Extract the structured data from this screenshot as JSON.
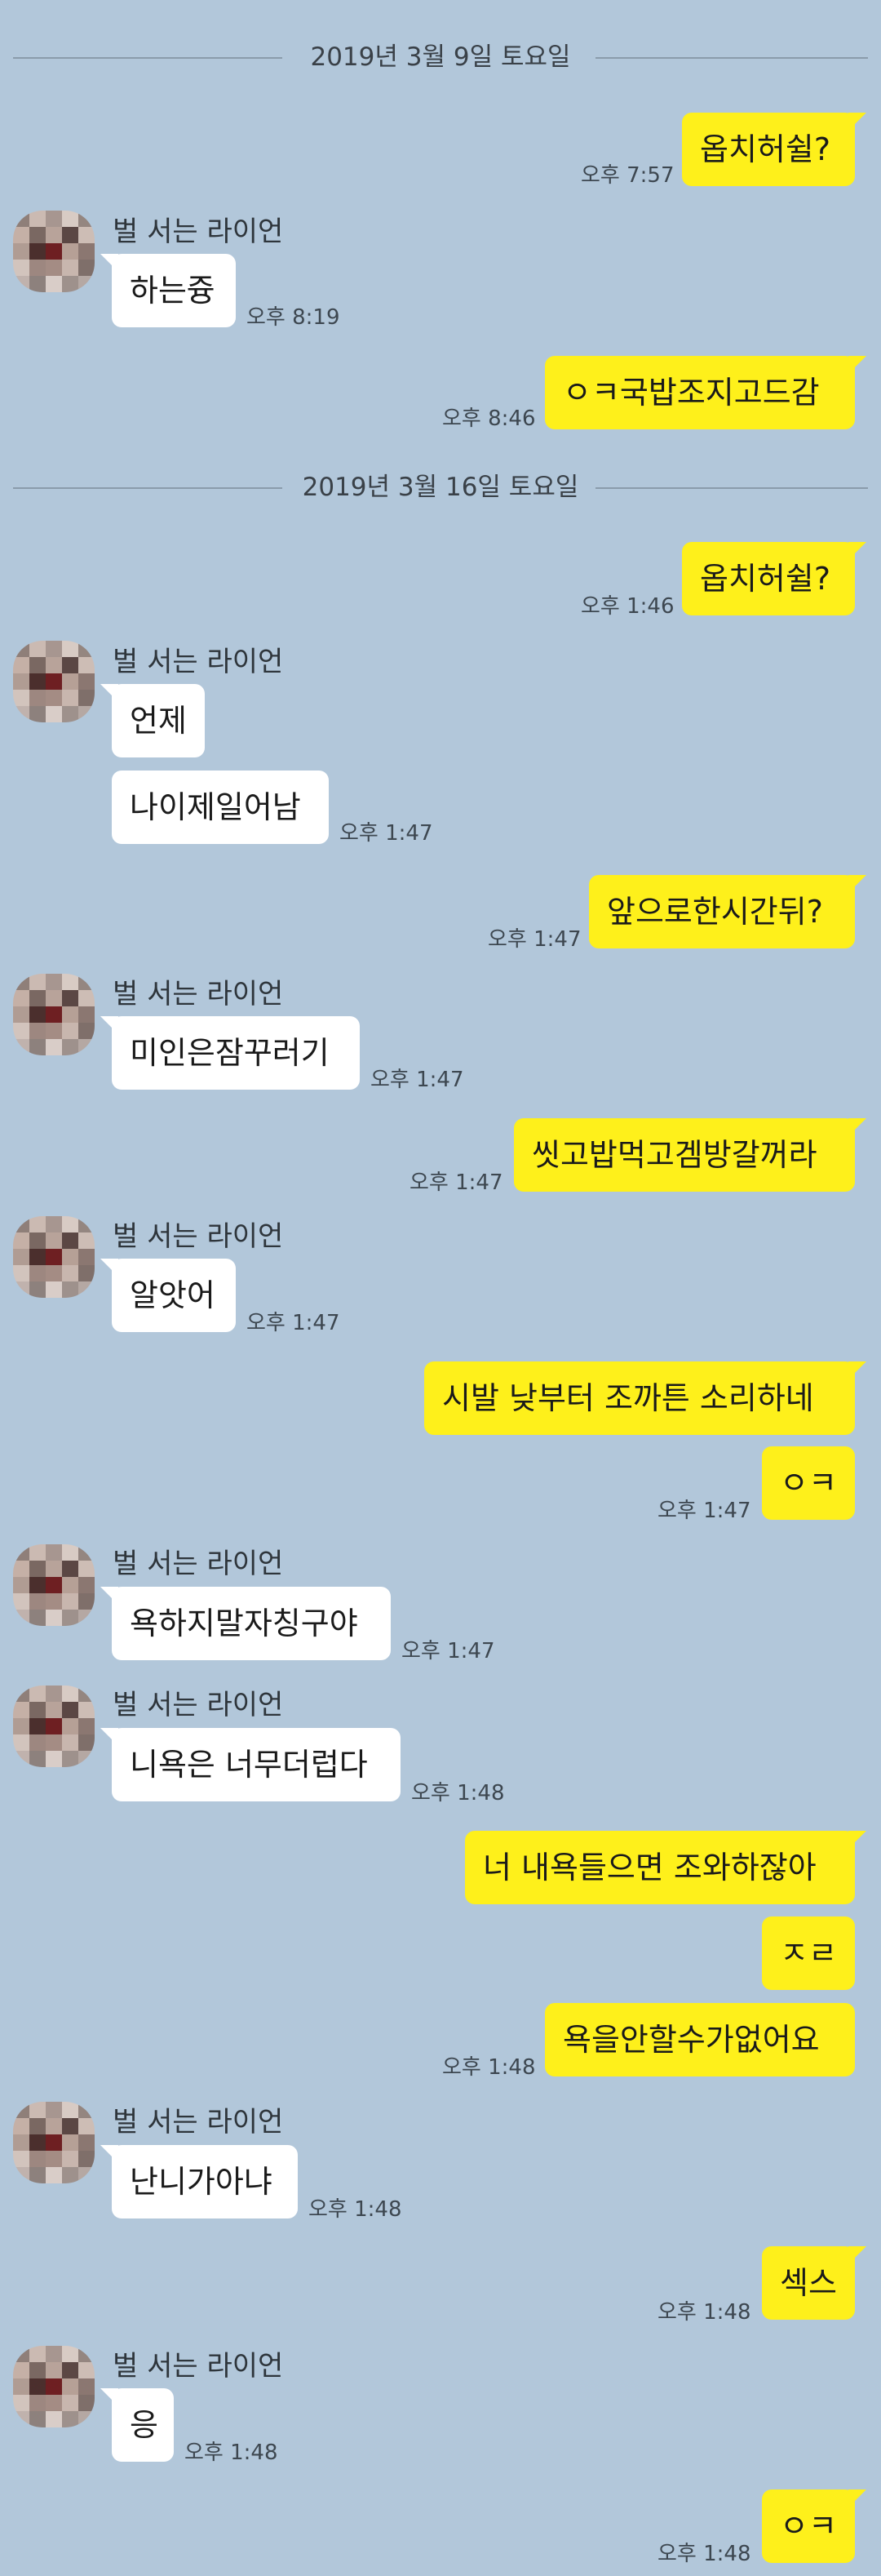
{
  "dividers": [
    "2019년 3월 9일 토요일",
    "2019년 3월 16일 토요일"
  ],
  "sender_name": "벌 서는 라이언",
  "messages": [
    {
      "text": "옵치허쉴?",
      "time": "오후 7:57"
    },
    {
      "text": "하는즁",
      "time": "오후 8:19"
    },
    {
      "text": "ㅇㅋ국밥조지고드감",
      "time": "오후 8:46"
    },
    {
      "text": "옵치허쉴?",
      "time": "오후 1:46"
    },
    {
      "text": "언제",
      "time": ""
    },
    {
      "text": "나이제일어남",
      "time": "오후 1:47"
    },
    {
      "text": "앞으로한시간뒤?",
      "time": "오후 1:47"
    },
    {
      "text": "미인은잠꾸러기",
      "time": "오후 1:47"
    },
    {
      "text": "씻고밥먹고겜방갈꺼라",
      "time": "오후 1:47"
    },
    {
      "text": "알앗어",
      "time": "오후 1:47"
    },
    {
      "text": "시발 낮부터 조까튼 소리하네",
      "time": ""
    },
    {
      "text": "ㅇㅋ",
      "time": "오후 1:47"
    },
    {
      "text": "욕하지말자칭구야",
      "time": "오후 1:47"
    },
    {
      "text": "니욕은 너무더럽다",
      "time": "오후 1:48"
    },
    {
      "text": "너 내욕들으면 조와하잖아",
      "time": ""
    },
    {
      "text": "ㅈㄹ",
      "time": ""
    },
    {
      "text": "욕을안할수가없어요",
      "time": "오후 1:48"
    },
    {
      "text": "난니가아냐",
      "time": "오후 1:48"
    },
    {
      "text": "섹스",
      "time": "오후 1:48"
    },
    {
      "text": "응",
      "time": "오후 1:48"
    },
    {
      "text": "ㅇㅋ",
      "time": "오후 1:48"
    }
  ],
  "colors": {
    "background": "#b2c7da",
    "my_bubble": "#fef01b",
    "other_bubble": "#ffffff"
  }
}
